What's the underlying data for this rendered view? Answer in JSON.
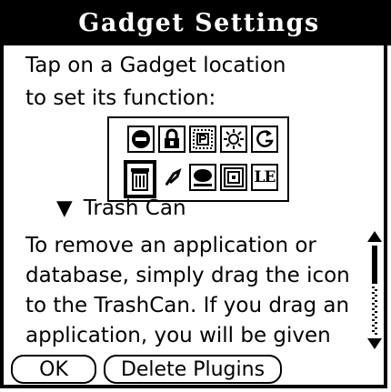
{
  "dialog": {
    "title": "Gadget Settings",
    "instruction_line1": "Tap on a Gadget location",
    "instruction_line2": "to set its function:"
  },
  "gadgets": {
    "row1": [
      "power-icon",
      "lock-icon",
      "parking-p-icon",
      "brightness-icon",
      "rotate-icon"
    ],
    "row2": [
      "trash-can-icon",
      "beam-icon",
      "speech-bubble-icon",
      "square-target-icon",
      "le-text-icon"
    ],
    "selected": "trash-can-icon"
  },
  "function_trigger": {
    "arrow": "▼",
    "label": "Trash Can"
  },
  "description": {
    "lines": [
      "To remove an application or",
      "database, simply drag the icon",
      "to the TrashCan.  If you drag an",
      "application, you will be given"
    ]
  },
  "buttons": {
    "ok_label": "OK",
    "delete_plugins_label": "Delete Plugins"
  },
  "le_label": "LE"
}
